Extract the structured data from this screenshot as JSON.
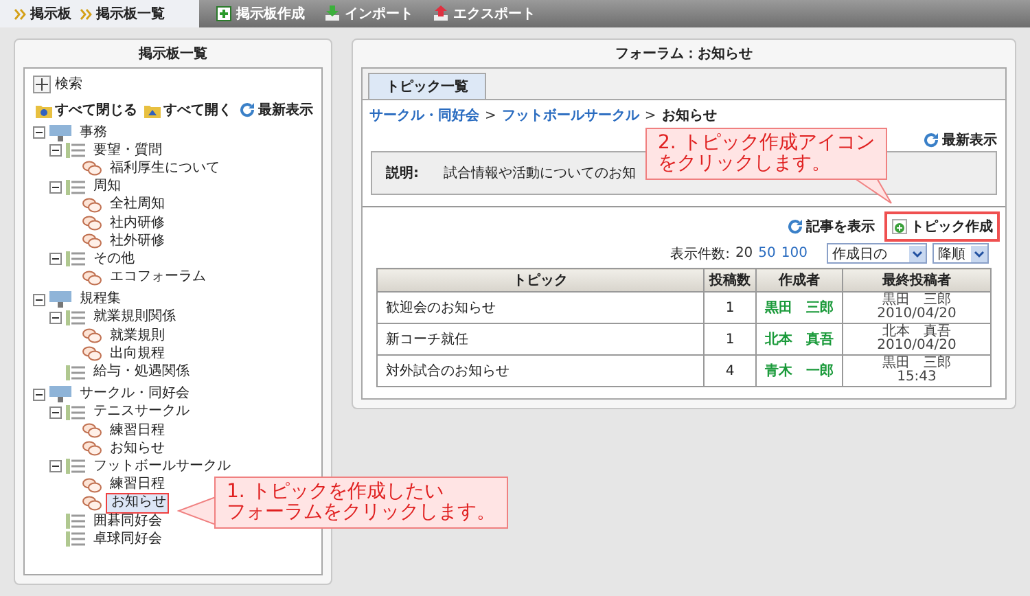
{
  "top_bar": {
    "breadcrumb": [
      "掲示板",
      "掲示板一覧"
    ],
    "actions": [
      {
        "kind": "create",
        "label": "掲示板作成"
      },
      {
        "kind": "import",
        "label": "インポート"
      },
      {
        "kind": "export",
        "label": "エクスポート"
      }
    ]
  },
  "left_panel": {
    "title": "掲示板一覧",
    "search": {
      "label": "検索",
      "expanded": false
    },
    "tools": [
      {
        "kind": "collapse",
        "label": "すべて閉じる"
      },
      {
        "kind": "expand",
        "label": "すべて開く"
      },
      {
        "kind": "refresh",
        "label": "最新表示"
      }
    ],
    "tree": [
      {
        "label": "事務",
        "kind": "category",
        "expanded": true,
        "selected": false,
        "children": [
          {
            "label": "要望・質問",
            "kind": "group",
            "expanded": true,
            "selected": false,
            "children": [
              {
                "label": "福利厚生について",
                "kind": "forum",
                "selected": false
              }
            ]
          },
          {
            "label": "周知",
            "kind": "group",
            "expanded": true,
            "selected": false,
            "children": [
              {
                "label": "全社周知",
                "kind": "forum",
                "selected": false
              },
              {
                "label": "社内研修",
                "kind": "forum",
                "selected": false
              },
              {
                "label": "社外研修",
                "kind": "forum",
                "selected": false
              }
            ]
          },
          {
            "label": "その他",
            "kind": "group",
            "expanded": true,
            "selected": false,
            "children": [
              {
                "label": "エコフォーラム",
                "kind": "forum",
                "selected": false
              }
            ]
          }
        ]
      },
      {
        "label": "規程集",
        "kind": "category",
        "expanded": true,
        "selected": false,
        "children": [
          {
            "label": "就業規則関係",
            "kind": "group",
            "expanded": true,
            "selected": false,
            "children": [
              {
                "label": "就業規則",
                "kind": "forum",
                "selected": false
              },
              {
                "label": "出向規程",
                "kind": "forum",
                "selected": false
              }
            ]
          },
          {
            "label": "給与・処遇関係",
            "kind": "group",
            "selected": false
          }
        ]
      },
      {
        "label": "サークル・同好会",
        "kind": "category",
        "expanded": true,
        "selected": false,
        "children": [
          {
            "label": "テニスサークル",
            "kind": "group",
            "expanded": true,
            "selected": false,
            "children": [
              {
                "label": "練習日程",
                "kind": "forum",
                "selected": false
              },
              {
                "label": "お知らせ",
                "kind": "forum",
                "selected": false
              }
            ]
          },
          {
            "label": "フットボールサークル",
            "kind": "group",
            "expanded": true,
            "selected": false,
            "children": [
              {
                "label": "練習日程",
                "kind": "forum",
                "selected": false
              },
              {
                "label": "お知らせ",
                "kind": "forum",
                "selected": true
              }
            ]
          },
          {
            "label": "囲碁同好会",
            "kind": "group",
            "selected": false
          },
          {
            "label": "卓球同好会",
            "kind": "group",
            "selected": false
          }
        ]
      }
    ]
  },
  "right_panel": {
    "title": "フォーラム：お知らせ",
    "tabs": [
      {
        "label": "トピック一覧",
        "selected": true
      }
    ],
    "breadcrumb": {
      "links": [
        "サークル・同好会",
        "フットボールサークル"
      ],
      "separators": [
        ">",
        ">"
      ],
      "current": "お知らせ"
    },
    "toolbar": [
      {
        "kind": "refresh",
        "label": "最新表示"
      }
    ],
    "description": {
      "label": "説明:",
      "text": "試合情報や活動についてのお知"
    },
    "actions": [
      {
        "kind": "refresh",
        "label": "記事を表示",
        "highlighted": false
      },
      {
        "kind": "create",
        "label": "トピック作成",
        "highlighted": true
      }
    ],
    "page_size": {
      "label": "表示件数:",
      "options": [
        {
          "label": "20",
          "selected": true
        },
        {
          "label": "50",
          "selected": false
        },
        {
          "label": "100",
          "selected": false
        }
      ]
    },
    "sort": [
      {
        "value": "作成日の",
        "wide": true
      },
      {
        "value": "降順",
        "wide": false
      }
    ],
    "table": {
      "columns": [
        "トピック",
        "投稿数",
        "作成者",
        "最終投稿者"
      ],
      "rows": [
        {
          "topic": "歓迎会のお知らせ",
          "posts": "1",
          "author": "黒田　三郎",
          "last_poster": "黒田　三郎",
          "last_time": "2010/04/20"
        },
        {
          "topic": "新コーチ就任",
          "posts": "1",
          "author": "北本　真吾",
          "last_poster": "北本　真吾",
          "last_time": "2010/04/20"
        },
        {
          "topic": "対外試合のお知らせ",
          "posts": "4",
          "author": "青木　一郎",
          "last_poster": "黒田　三郎",
          "last_time": "15:43"
        }
      ]
    }
  },
  "callouts": [
    {
      "kind": "left",
      "lines": [
        "1. トピックを作成したい",
        "フォーラムをクリックします。"
      ]
    },
    {
      "kind": "down",
      "lines": [
        "2. トピック作成アイコン",
        "をクリックします。"
      ]
    }
  ]
}
